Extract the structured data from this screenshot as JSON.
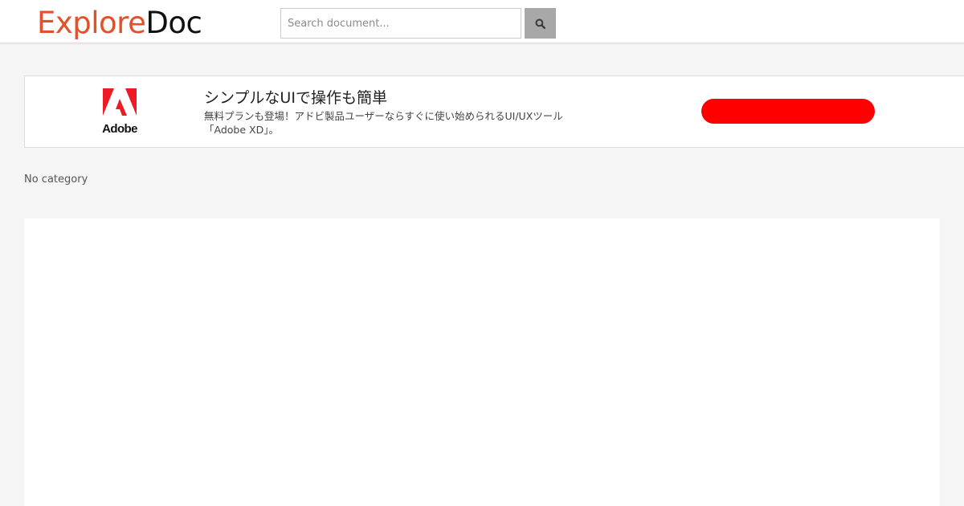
{
  "header": {
    "logo_part1": "Explore",
    "logo_part2": "Doc",
    "search_placeholder": "Search document...",
    "search_icon": "search-icon"
  },
  "ad": {
    "brand": "Adobe",
    "logo_icon": "adobe-logo-icon",
    "title": "シンプルなUIで操作も簡単",
    "description": "無料プランも登場！アドビ製品ユーザーならすぐに使い始められるUI/UXツール「Adobe XD」。",
    "cta_label": "",
    "cta_color": "#fe0000",
    "brand_color": "#e2522a"
  },
  "category": {
    "label": "No category"
  }
}
